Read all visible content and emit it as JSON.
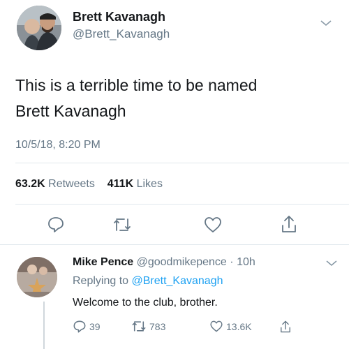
{
  "main_tweet": {
    "display_name": "Brett Kavanagh",
    "handle": "@Brett_Kavanagh",
    "text_line1": "This is a terrible time to be named",
    "text_line2": "Brett Kavanagh",
    "timestamp": "10/5/18, 8:20 PM",
    "retweets_count": "63.2K",
    "retweets_label": "Retweets",
    "likes_count": "411K",
    "likes_label": "Likes",
    "actions": [
      "reply-icon",
      "retweet-icon",
      "heart-icon",
      "share-icon"
    ]
  },
  "reply_tweet": {
    "display_name": "Mike Pence",
    "handle": "@goodmikepence",
    "separator": "·",
    "time_ago": "10h",
    "replying_prefix": "Replying to",
    "replying_mention": "@Brett_Kavanagh",
    "text": "Welcome to the club, brother.",
    "reply_count": "39",
    "retweet_count": "783",
    "like_count": "13.6K"
  },
  "colors": {
    "text_primary": "#14171a",
    "text_secondary": "#657786",
    "link": "#1da1f2",
    "divider": "#e1e8ed"
  }
}
